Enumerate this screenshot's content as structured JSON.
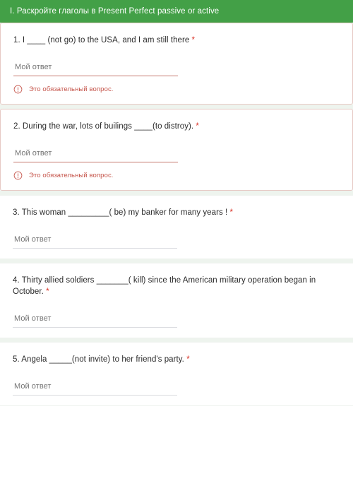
{
  "header": {
    "title": "I. Раскройте глаголы в Present Perfect passive or active",
    "background_color": "#43a047",
    "text_color": "#ffffff"
  },
  "colors": {
    "accent_green": "#43a047",
    "error_red": "#c5544a",
    "required_star": "#d93025",
    "underline_gray": "#dadce0",
    "underline_error": "#c5796f",
    "card_border_error": "#e6c9c4",
    "page_background": "#eef4ee"
  },
  "answer_placeholder": "Мой ответ",
  "required_marker": "*",
  "error_message": "Это обязательный вопрос.",
  "error_icon_name": "exclamation-circle-icon",
  "questions": [
    {
      "number": "1.",
      "text": "1. I ____ (not go) to the USA, and I am still there",
      "required": true,
      "has_error": true
    },
    {
      "number": "2.",
      "text": "2. During the war, lots of builings ____(to distroy).",
      "required": true,
      "has_error": true
    },
    {
      "number": "3.",
      "text": "3. This woman _________( be) my banker for many years !",
      "required": true,
      "has_error": false
    },
    {
      "number": "4.",
      "text": "4. Thirty allied soldiers _______( kill) since the American military operation began in October.",
      "required": true,
      "has_error": false
    },
    {
      "number": "5.",
      "text": "5. Angela _____(not invite) to her friend's party.",
      "required": true,
      "has_error": false
    }
  ]
}
